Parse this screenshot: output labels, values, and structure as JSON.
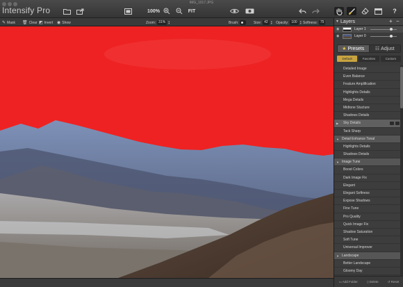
{
  "window": {
    "title": "IMG_1017.JPG",
    "app_title": "Intensify Pro"
  },
  "toolbar": {
    "zoom_100": "100%",
    "fit": "FIT",
    "help": "?"
  },
  "options": {
    "mask": "Mask",
    "clear": "Clear",
    "invert": "Invert",
    "show": "Show",
    "zoom_label": "Zoom:",
    "zoom_value": "31%",
    "brush_label": "Brush:",
    "size_label": "Size:",
    "size_value": "42",
    "opacity_label": "Opacity:",
    "opacity_value": "100",
    "softness_label": "Softness:",
    "softness_value": "75"
  },
  "layers": {
    "title": "Layers",
    "items": [
      {
        "name": "Layer 1"
      },
      {
        "name": "Layer 0"
      }
    ]
  },
  "tabs": {
    "presets": "Presets",
    "adjust": "Adjust"
  },
  "subtabs": {
    "default": "Default",
    "favorites": "Favorites",
    "custom": "Custom"
  },
  "presets": [
    {
      "label": "Detailed Image",
      "kind": "item"
    },
    {
      "label": "Even Balance",
      "kind": "item"
    },
    {
      "label": "Feature Amplification",
      "kind": "item"
    },
    {
      "label": "Highlights Details",
      "kind": "item"
    },
    {
      "label": "Mega Details",
      "kind": "item"
    },
    {
      "label": "Midtone Stucture",
      "kind": "item"
    },
    {
      "label": "Shadows Details",
      "kind": "item"
    },
    {
      "label": "Sky Details",
      "kind": "selected"
    },
    {
      "label": "Tack Sharp",
      "kind": "item"
    },
    {
      "label": "Detail Enhance Tonal",
      "kind": "cat"
    },
    {
      "label": "Highlights Details",
      "kind": "item"
    },
    {
      "label": "Shadows Details",
      "kind": "item"
    },
    {
      "label": "Image Tune",
      "kind": "cat"
    },
    {
      "label": "Boost Colors",
      "kind": "item"
    },
    {
      "label": "Dark Image Fix",
      "kind": "item"
    },
    {
      "label": "Elegant",
      "kind": "item"
    },
    {
      "label": "Elegant Softness",
      "kind": "item"
    },
    {
      "label": "Expose Shadows",
      "kind": "item"
    },
    {
      "label": "Fine Tune",
      "kind": "item"
    },
    {
      "label": "Pro Quality",
      "kind": "item"
    },
    {
      "label": "Quick Image Fix",
      "kind": "item"
    },
    {
      "label": "Shadow Saturation",
      "kind": "item"
    },
    {
      "label": "Soft Tune",
      "kind": "item"
    },
    {
      "label": "Universal Improver",
      "kind": "item"
    },
    {
      "label": "Landscape",
      "kind": "cat"
    },
    {
      "label": "Better Landscape",
      "kind": "item"
    },
    {
      "label": "Gloomy Day",
      "kind": "item"
    }
  ],
  "footer": {
    "add_folder": "Add Folder",
    "delete": "Delete",
    "reset": "Reset"
  },
  "colors": {
    "mask_red": "#ee2222",
    "accent_gold": "#c8a441"
  }
}
